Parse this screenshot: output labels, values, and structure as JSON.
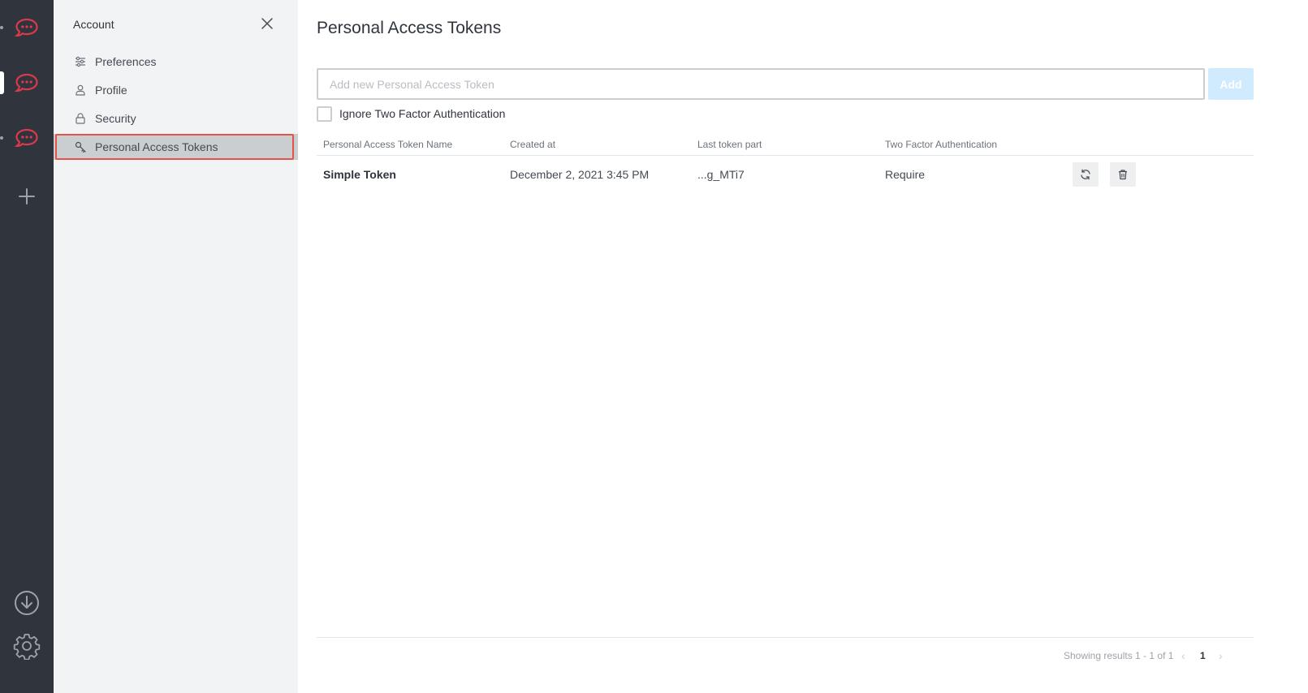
{
  "rail": {
    "servers": [
      "rocketchat-logo-icon",
      "rocketchat-logo-icon",
      "rocketchat-logo-icon"
    ],
    "accent": "#db3a4a"
  },
  "sidebar": {
    "title": "Account",
    "items": [
      {
        "label": "Preferences",
        "icon": "sliders-icon",
        "active": false
      },
      {
        "label": "Profile",
        "icon": "user-icon",
        "active": false
      },
      {
        "label": "Security",
        "icon": "lock-icon",
        "active": false
      },
      {
        "label": "Personal Access Tokens",
        "icon": "key-icon",
        "active": true
      }
    ]
  },
  "main": {
    "title": "Personal Access Tokens",
    "input_placeholder": "Add new Personal Access Token",
    "add_label": "Add",
    "checkbox_label": "Ignore Two Factor Authentication",
    "checkbox_checked": false,
    "table": {
      "headers": [
        "Personal Access Token Name",
        "Created at",
        "Last token part",
        "Two Factor Authentication"
      ],
      "rows": [
        {
          "name": "Simple Token",
          "created": "December 2, 2021 3:45 PM",
          "last_part": "...g_MTi7",
          "two_factor": "Require"
        }
      ]
    },
    "footer": {
      "results": "Showing results 1 - 1 of 1",
      "prev": "‹",
      "page": "1",
      "next": "›"
    }
  }
}
